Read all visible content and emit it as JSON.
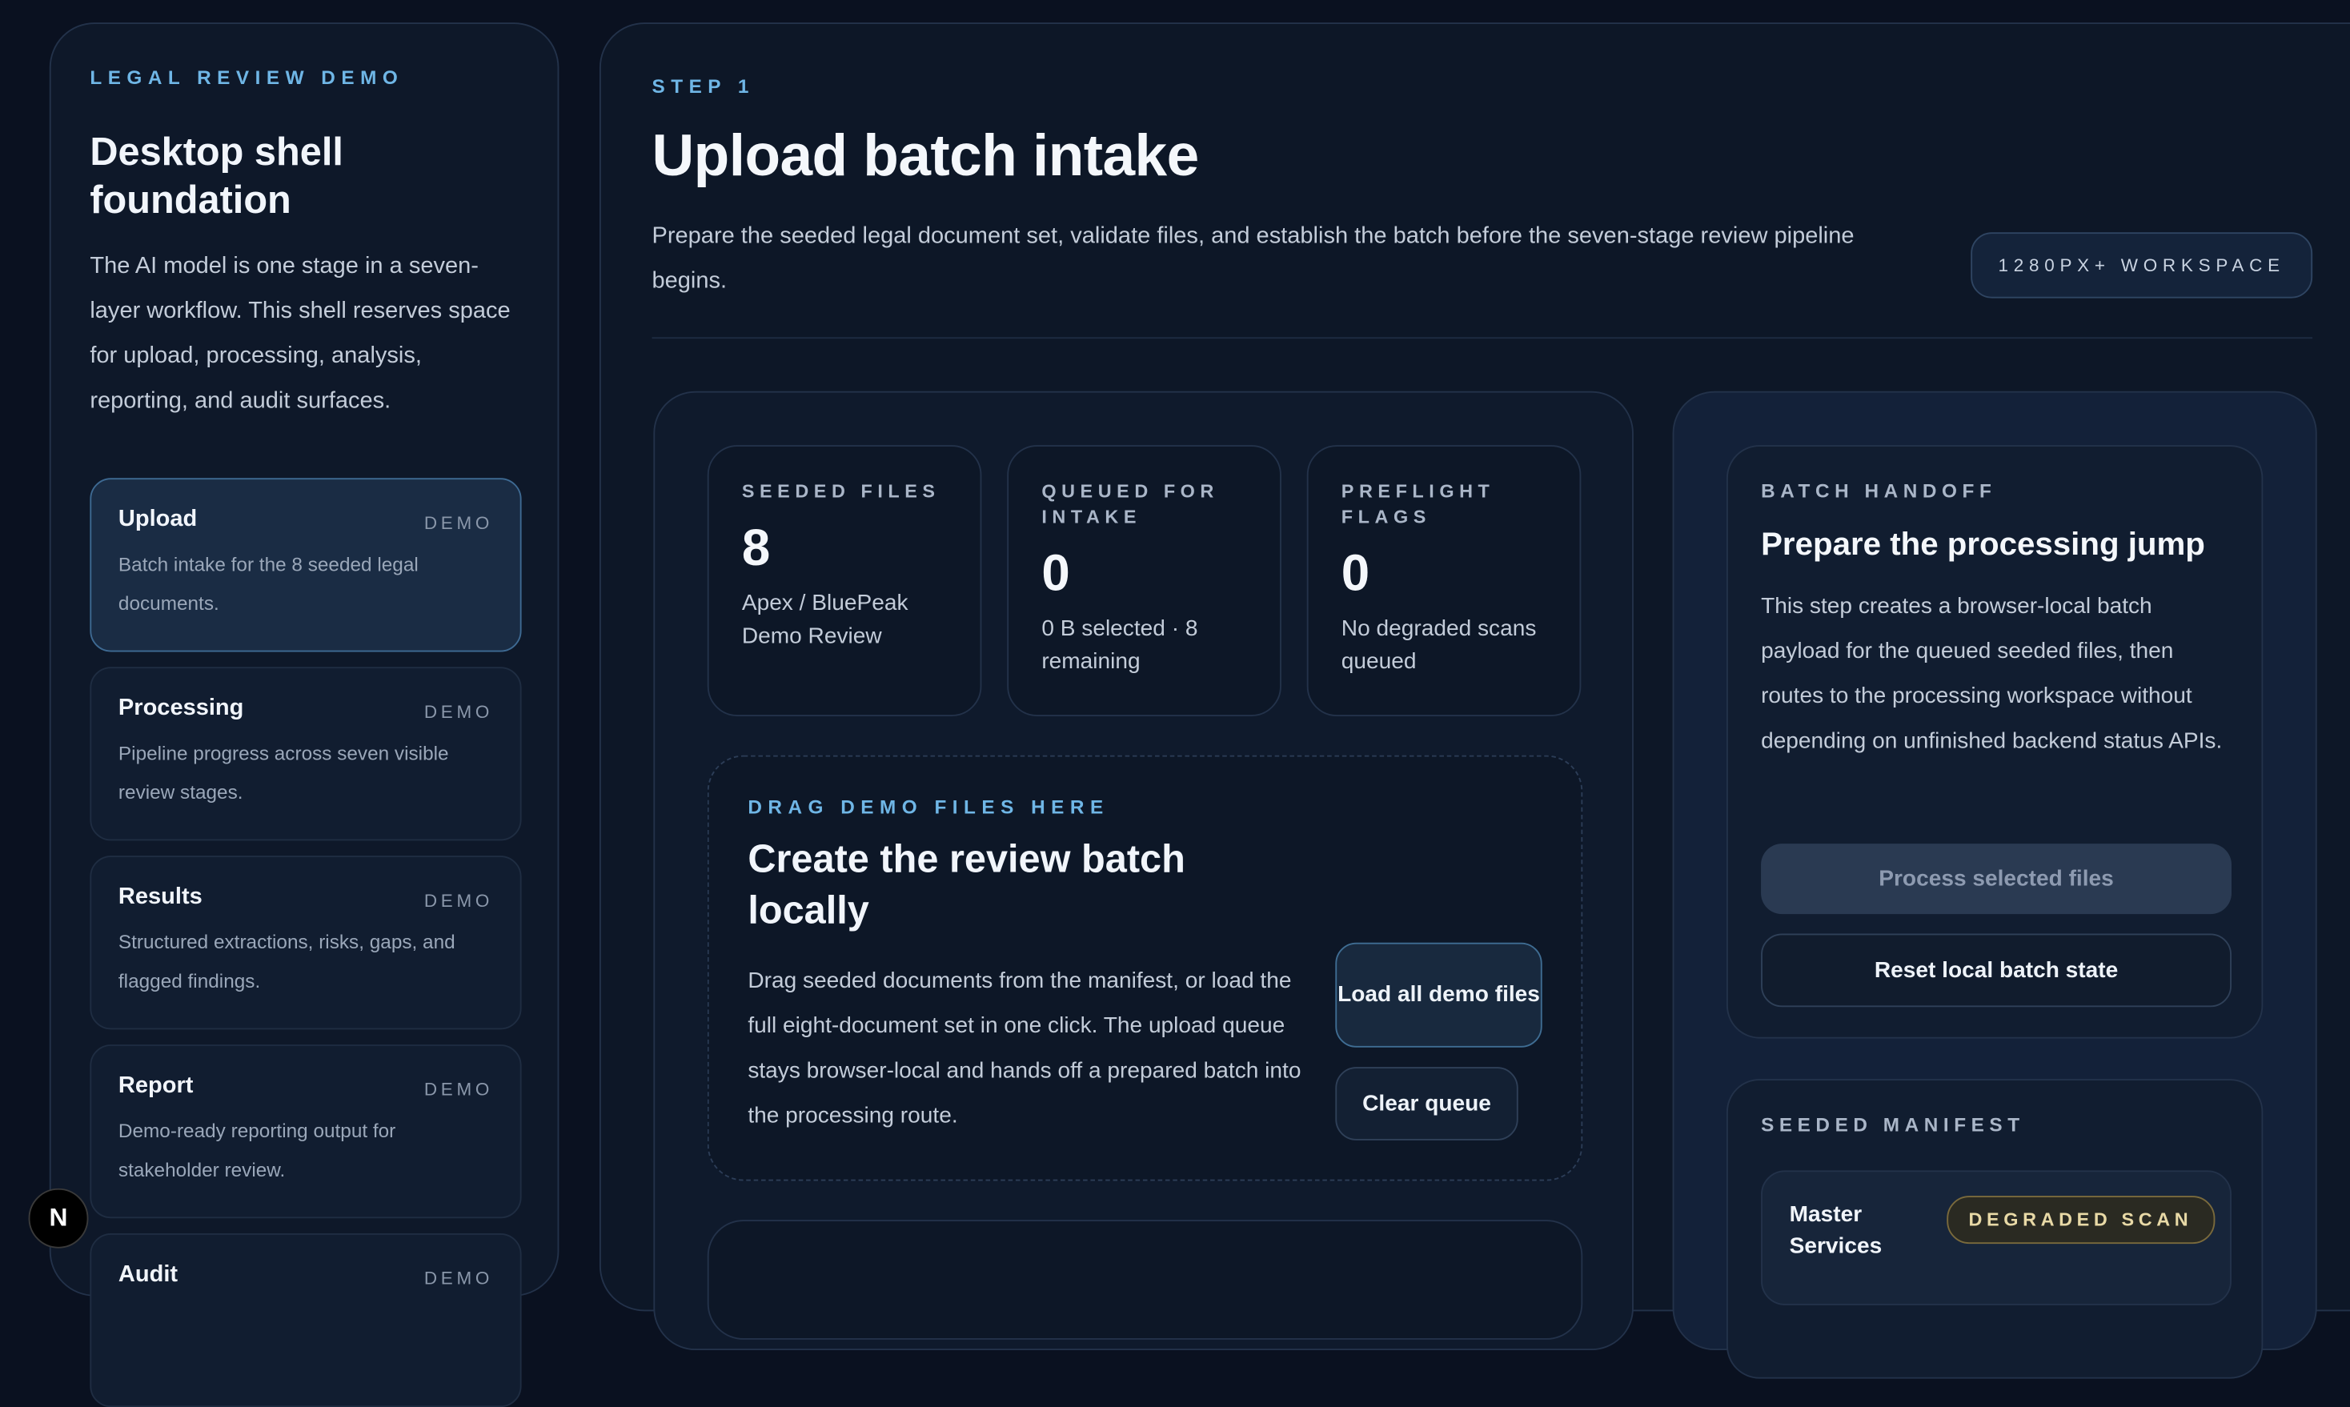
{
  "sidebar": {
    "eyebrow": "LEGAL REVIEW DEMO",
    "title": "Desktop shell foundation",
    "description": "The AI model is one stage in a seven-layer workflow. This shell reserves space for upload, processing, analysis, reporting, and audit surfaces.",
    "items": [
      {
        "title": "Upload",
        "tag": "DEMO",
        "sub": "Batch intake for the 8 seeded legal documents."
      },
      {
        "title": "Processing",
        "tag": "DEMO",
        "sub": "Pipeline progress across seven visible review stages."
      },
      {
        "title": "Results",
        "tag": "DEMO",
        "sub": "Structured extractions, risks, gaps, and flagged findings."
      },
      {
        "title": "Report",
        "tag": "DEMO",
        "sub": "Demo-ready reporting output for stakeholder review."
      },
      {
        "title": "Audit",
        "tag": "DEMO",
        "sub": ""
      }
    ]
  },
  "header": {
    "step": "STEP 1",
    "title": "Upload batch intake",
    "lead": "Prepare the seeded legal document set, validate files, and establish the batch before the seven-stage review pipeline begins.",
    "chip": "1280PX+ WORKSPACE"
  },
  "stats": [
    {
      "label": "SEEDED FILES",
      "value": "8",
      "note": "Apex / BluePeak Demo Review"
    },
    {
      "label": "QUEUED FOR INTAKE",
      "value": "0",
      "note": "0 B selected · 8 remaining"
    },
    {
      "label": "PREFLIGHT FLAGS",
      "value": "0",
      "note": "No degraded scans queued"
    }
  ],
  "drop": {
    "eyebrow": "DRAG DEMO FILES HERE",
    "title": "Create the review batch locally",
    "text": "Drag seeded documents from the manifest, or load the full eight-document set in one click. The upload queue stays browser-local and hands off a prepared batch into the processing route.",
    "load_label": "Load all demo files",
    "clear_label": "Clear queue"
  },
  "handoff": {
    "label": "BATCH HANDOFF",
    "title": "Prepare the processing jump",
    "text": "This step creates a browser-local batch payload for the queued seeded files, then routes to the processing workspace without depending on unfinished backend status APIs.",
    "process_label": "Process selected files",
    "reset_label": "Reset local batch state"
  },
  "manifest": {
    "label": "SEEDED MANIFEST",
    "first_item": {
      "name": "Master Services",
      "badge": "DEGRADED SCAN"
    }
  },
  "dev_badge": "N"
}
